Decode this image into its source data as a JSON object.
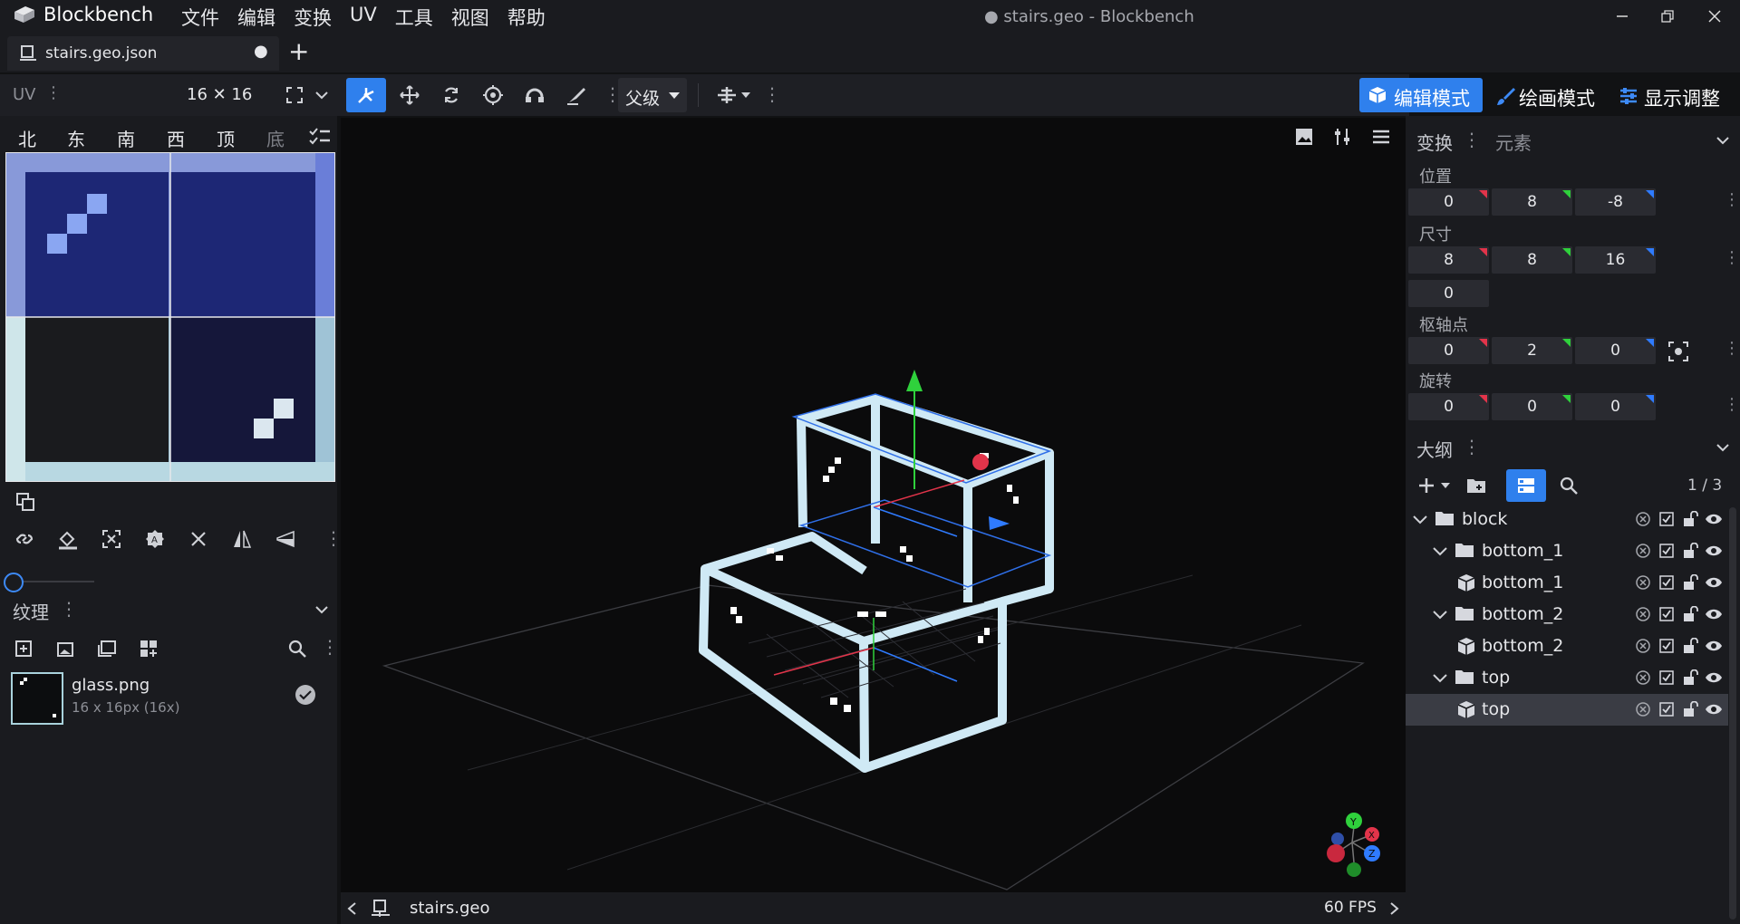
{
  "app": {
    "name": "Blockbench",
    "window_title": "● stairs.geo - Blockbench"
  },
  "menu": [
    "文件",
    "编辑",
    "变换",
    "UV",
    "工具",
    "视图",
    "帮助"
  ],
  "tabs": [
    {
      "label": "stairs.geo.json",
      "close": "●"
    }
  ],
  "new_tab": "+",
  "uv_panel": {
    "title": "UV",
    "size": "16 ✕ 16",
    "faces": [
      "北",
      "东",
      "南",
      "西",
      "顶",
      "底"
    ]
  },
  "toolbar": {
    "parent_label": "父级"
  },
  "modes": [
    {
      "label": "编辑模式",
      "active": true
    },
    {
      "label": "绘画模式",
      "active": false
    },
    {
      "label": "显示调整",
      "active": false
    }
  ],
  "textures": {
    "title": "纹理",
    "items": [
      {
        "name": "glass.png",
        "info": "16 x 16px (16x)"
      }
    ]
  },
  "viewport": {
    "footer_name": "stairs.geo",
    "fps": "60 FPS"
  },
  "gizmo": {
    "x": "X",
    "y": "Y",
    "z": "Z"
  },
  "transform": {
    "title": "变换",
    "tab2": "元素",
    "position": {
      "label": "位置",
      "values": [
        "0",
        "8",
        "-8"
      ]
    },
    "size": {
      "label": "尺寸",
      "values": [
        "8",
        "8",
        "16"
      ],
      "inflate": "0"
    },
    "pivot": {
      "label": "枢轴点",
      "values": [
        "0",
        "2",
        "0"
      ]
    },
    "rotation": {
      "label": "旋转",
      "values": [
        "0",
        "0",
        "0"
      ]
    }
  },
  "outliner": {
    "title": "大纲",
    "count": "1 / 3",
    "items": [
      {
        "label": "block",
        "type": "group",
        "depth": 0,
        "selected": false
      },
      {
        "label": "bottom_1",
        "type": "group",
        "depth": 1,
        "selected": false
      },
      {
        "label": "bottom_1",
        "type": "cube",
        "depth": 2,
        "selected": false
      },
      {
        "label": "bottom_2",
        "type": "group",
        "depth": 1,
        "selected": false
      },
      {
        "label": "bottom_2",
        "type": "cube",
        "depth": 2,
        "selected": false
      },
      {
        "label": "top",
        "type": "group",
        "depth": 1,
        "selected": false
      },
      {
        "label": "top",
        "type": "cube",
        "depth": 2,
        "selected": true
      }
    ]
  },
  "colors": {
    "accent": "#2f80ed",
    "x_axis": "#e2344a",
    "y_axis": "#2fd13c",
    "z_axis": "#2f7bff",
    "glass": "#cfe9f5"
  }
}
